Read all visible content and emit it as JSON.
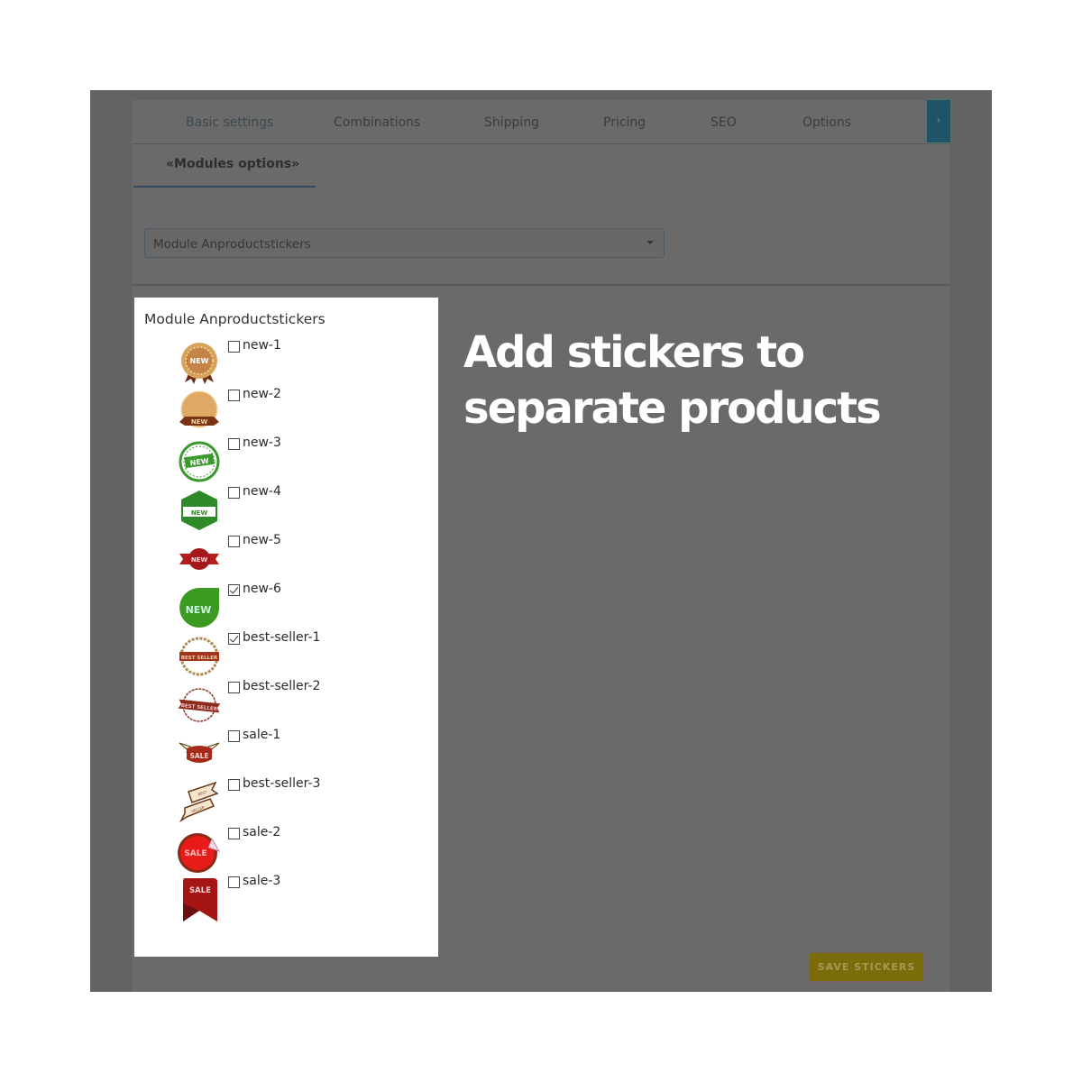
{
  "tabs": [
    {
      "label": "Basic settings"
    },
    {
      "label": "Combinations"
    },
    {
      "label": "Shipping"
    },
    {
      "label": "Pricing"
    },
    {
      "label": "SEO"
    },
    {
      "label": "Options"
    }
  ],
  "tabs_next_icon": "›",
  "subtab": {
    "label": "«Modules options»"
  },
  "module_select": {
    "value": "Module Anproductstickers"
  },
  "card": {
    "title": "Module Anproductstickers",
    "stickers": [
      {
        "label": "new-1",
        "checked": false,
        "icon": "gold-rosette-new-icon"
      },
      {
        "label": "new-2",
        "checked": false,
        "icon": "gold-badge-ribbon-new-icon"
      },
      {
        "label": "new-3",
        "checked": false,
        "icon": "green-seal-new-icon"
      },
      {
        "label": "new-4",
        "checked": false,
        "icon": "green-hexagon-new-icon"
      },
      {
        "label": "new-5",
        "checked": false,
        "icon": "red-ribbon-new-icon"
      },
      {
        "label": "new-6",
        "checked": true,
        "icon": "green-leaf-new-icon"
      },
      {
        "label": "best-seller-1",
        "checked": true,
        "icon": "best-seller-seal-icon"
      },
      {
        "label": "best-seller-2",
        "checked": false,
        "icon": "best-seller-ribbon-icon"
      },
      {
        "label": "sale-1",
        "checked": false,
        "icon": "sale-banner-icon"
      },
      {
        "label": "best-seller-3",
        "checked": false,
        "icon": "best-seller-scroll-icon"
      },
      {
        "label": "sale-2",
        "checked": false,
        "icon": "sale-peel-sticker-icon"
      },
      {
        "label": "sale-3",
        "checked": false,
        "icon": "sale-bookmark-icon"
      }
    ]
  },
  "headline": {
    "line1": "Add stickers to",
    "line2": "separate products"
  },
  "save_button": {
    "label": "SAVE STICKERS"
  },
  "colors": {
    "overlay_bg": "#626262",
    "card_bg": "#ffffff",
    "next_button": "#1f5468",
    "save_button": "#7b6c0a"
  }
}
